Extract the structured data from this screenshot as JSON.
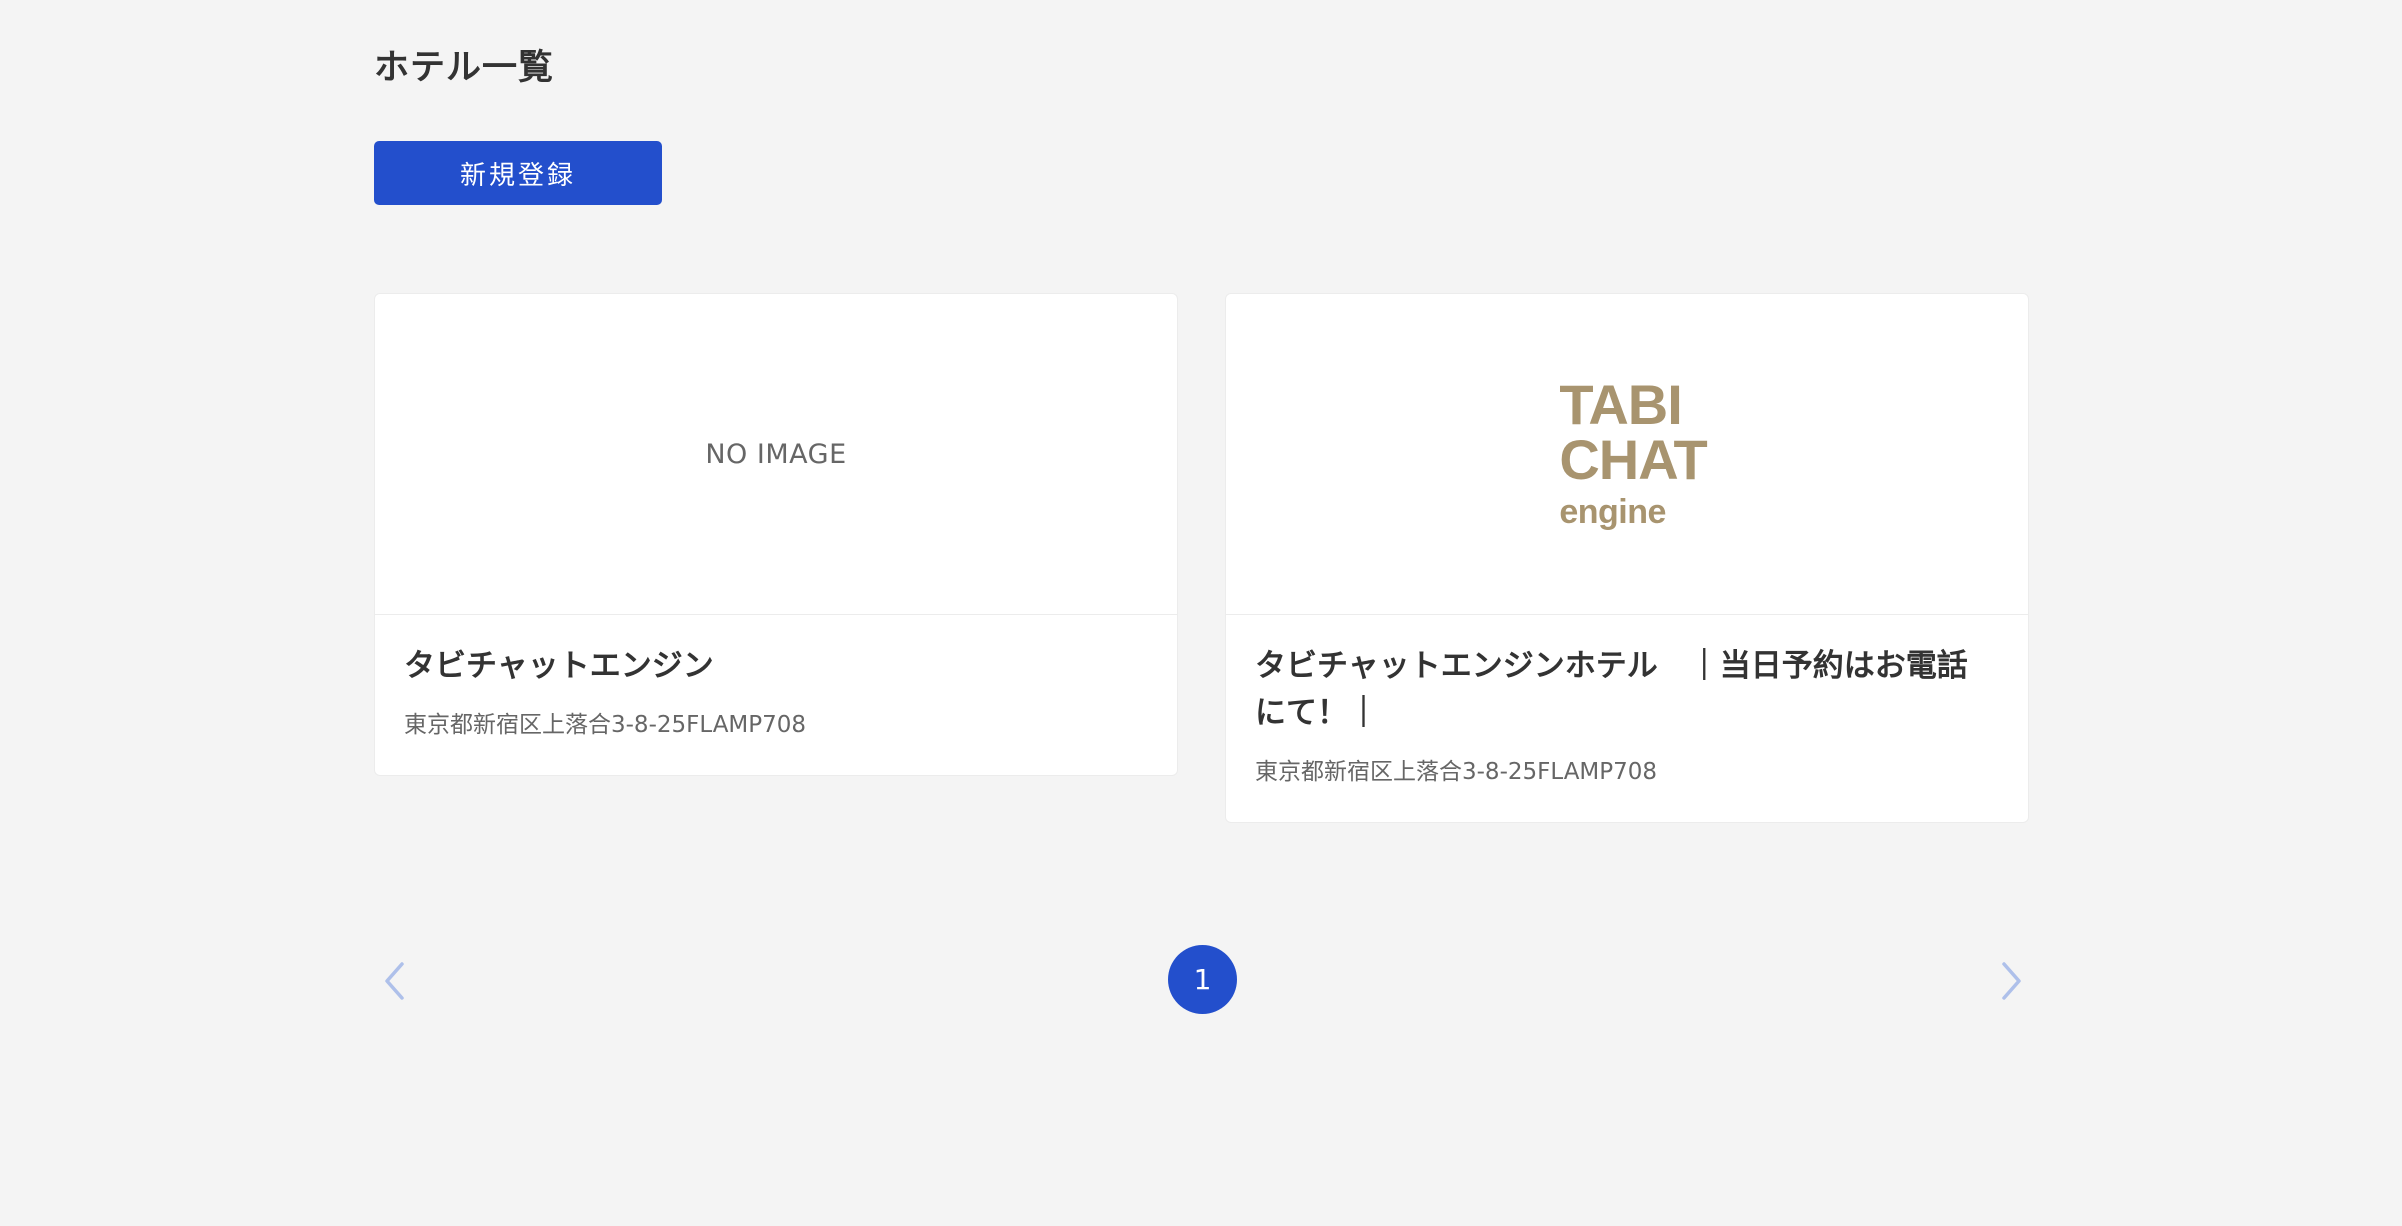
{
  "page": {
    "title": "ホテル一覧"
  },
  "toolbar": {
    "new_button_label": "新規登録"
  },
  "hotels": [
    {
      "image_placeholder": "NO IMAGE",
      "name": "タビチャットエンジン",
      "address": "東京都新宿区上落合3-8-25FLAMP708"
    },
    {
      "logo_lines": [
        "TABI",
        "CHAT",
        "engine"
      ],
      "name": "タビチャットエンジンホテル　｜当日予約はお電話にて！｜",
      "address": "東京都新宿区上落合3-8-25FLAMP708"
    }
  ],
  "pagination": {
    "prev_icon": "chevron-left-icon",
    "next_icon": "chevron-right-icon",
    "pages": [
      "1"
    ],
    "current_page": "1"
  },
  "colors": {
    "background": "#f4f4f4",
    "primary": "#234fcc",
    "logo": "#a8946f",
    "pager_arrow": "#aec0ea"
  }
}
